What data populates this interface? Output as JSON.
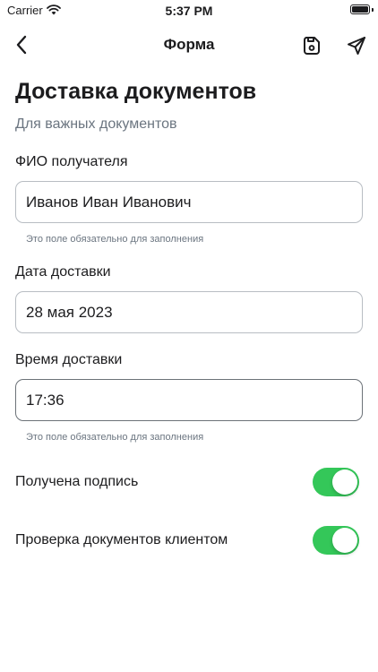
{
  "status_bar": {
    "carrier": "Carrier",
    "time": "5:37 PM"
  },
  "nav": {
    "title": "Форма",
    "icons": {
      "back": "chevron-left-icon",
      "save": "save-icon",
      "send": "send-icon"
    }
  },
  "page": {
    "title": "Доставка документов",
    "subtitle": "Для важных документов"
  },
  "fields": [
    {
      "label": "ФИО получателя",
      "value": "Иванов Иван Иванович",
      "hint": "Это поле обязательно для заполнения"
    },
    {
      "label": "Дата доставки",
      "value": "28 мая 2023"
    },
    {
      "label": "Время доставки",
      "value": "17:36",
      "hint": "Это поле обязательно для заполнения"
    }
  ],
  "toggles": [
    {
      "label": "Получена подпись",
      "on": true
    },
    {
      "label": "Проверка документов клиентом",
      "on": true
    }
  ],
  "colors": {
    "toggle_on": "#34c759",
    "hint_text": "#6b7580",
    "border": "#b8bdc3"
  }
}
